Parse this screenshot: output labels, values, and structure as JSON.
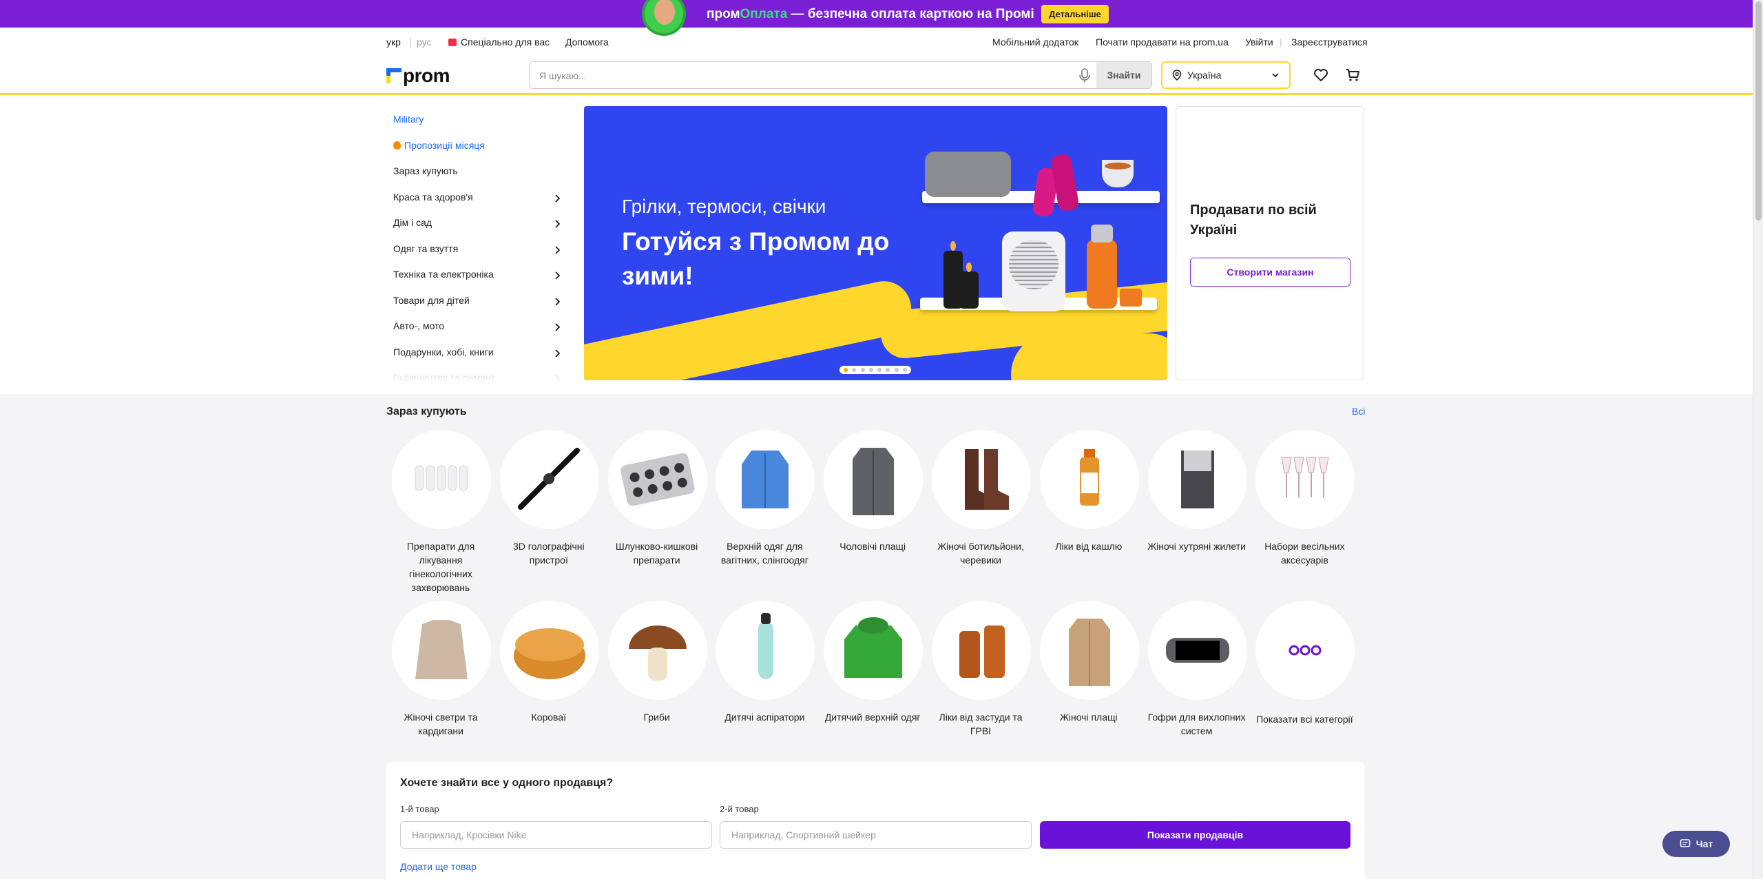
{
  "promo": {
    "text_prefix": "пром",
    "text_green": "Оплата",
    "text_rest": " — безпечна оплата карткою на Промі",
    "button": "Детальніше",
    "accent": "#7a1fd6"
  },
  "toplinks": {
    "lang_ukr": "укр",
    "lang_rus": "рус",
    "special": "Спеціально для вас",
    "help": "Допомога",
    "mobile_app": "Мобільний додаток",
    "start_selling": "Почати продавати на prom.ua",
    "login": "Увійти",
    "register": "Зареєструватися"
  },
  "header": {
    "logo": "prom",
    "search_placeholder": "Я шукаю...",
    "search_button": "Знайти",
    "region": "Україна"
  },
  "sidebar": {
    "items": [
      {
        "label": "Military",
        "style": "blue",
        "arrow": false
      },
      {
        "label": "Пропозиції місяця",
        "style": "blue",
        "arrow": false
      },
      {
        "label": "Зараз купують",
        "style": "normal",
        "arrow": false
      },
      {
        "label": "Краса та здоров'я",
        "style": "normal",
        "arrow": true
      },
      {
        "label": "Дім і сад",
        "style": "normal",
        "arrow": true
      },
      {
        "label": "Одяг та взуття",
        "style": "normal",
        "arrow": true
      },
      {
        "label": "Техніка та електроніка",
        "style": "normal",
        "arrow": true
      },
      {
        "label": "Товари для дітей",
        "style": "normal",
        "arrow": true
      },
      {
        "label": "Авто-, мото",
        "style": "normal",
        "arrow": true
      },
      {
        "label": "Подарунки, хобі, книги",
        "style": "normal",
        "arrow": true
      },
      {
        "label": "Будівництво та ремонт",
        "style": "faded",
        "arrow": true
      }
    ]
  },
  "banner": {
    "subtitle": "Грілки, термоси, свічки",
    "title": "Готуйся з Промом до зими!",
    "slides": 8,
    "active_slide": 1
  },
  "sell_card": {
    "title": "Продавати по всій Україні",
    "button": "Створити магазин"
  },
  "popular": {
    "title": "Зараз купують",
    "all_link": "Всі",
    "items": [
      {
        "label": "Препарати для лікування гінекологічних захворювань",
        "icon": "suppositories-icon"
      },
      {
        "label": "3D голографічні пристрої",
        "icon": "hologram-fan-icon"
      },
      {
        "label": "Шлунково-кишкові препарати",
        "icon": "pill-blister-icon"
      },
      {
        "label": "Верхній одяг для вагітних, слінгоодяг",
        "icon": "blue-jacket-icon"
      },
      {
        "label": "Чоловічі плащі",
        "icon": "coat-icon"
      },
      {
        "label": "Жіночі ботильйони, черевики",
        "icon": "boots-icon"
      },
      {
        "label": "Ліки від кашлю",
        "icon": "medicine-bottle-icon"
      },
      {
        "label": "Жіночі хутряні жилети",
        "icon": "fur-vest-icon"
      },
      {
        "label": "Набори весільних аксесуарів",
        "icon": "wedding-glasses-icon"
      },
      {
        "label": "Жіночі светри та кардигани",
        "icon": "sweater-icon"
      },
      {
        "label": "Короваї",
        "icon": "korovai-icon"
      },
      {
        "label": "Гриби",
        "icon": "mushroom-icon"
      },
      {
        "label": "Дитячі аспіратори",
        "icon": "aspirator-icon"
      },
      {
        "label": "Дитячий верхній одяг",
        "icon": "kids-jacket-icon"
      },
      {
        "label": "Ліки від застуди та ГРВІ",
        "icon": "cold-medicine-icon"
      },
      {
        "label": "Жіночі плащі",
        "icon": "trench-coat-icon"
      },
      {
        "label": "Гофри для вихлопних систем",
        "icon": "exhaust-flex-icon"
      },
      {
        "label": "Показати всі категорії",
        "icon": "more-dots-icon"
      }
    ]
  },
  "seller_search": {
    "title": "Хочете знайти все у одного продавця?",
    "label1": "1-й товар",
    "placeholder1": "Наприклад, Кросівки Nike",
    "label2": "2-й товар",
    "placeholder2": "Наприклад, Спортивний шейкер",
    "button": "Показати продавців",
    "add_more": "Додати ще товар"
  },
  "chat": {
    "label": "Чат"
  }
}
